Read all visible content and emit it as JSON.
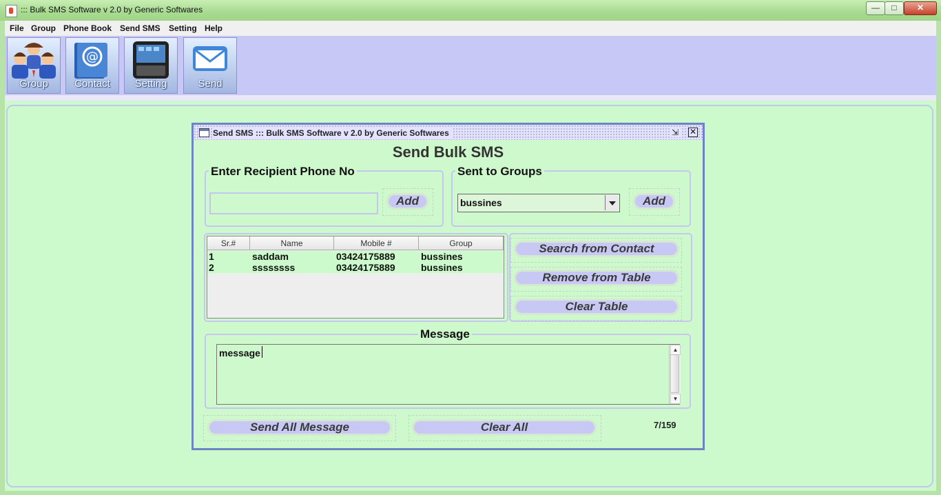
{
  "window": {
    "title": "::: Bulk SMS Software v 2.0 by Generic Softwares",
    "minimize_glyph": "—",
    "maximize_glyph": "□",
    "close_glyph": "✕"
  },
  "menu": [
    "File",
    "Group",
    "Phone Book",
    "Send SMS",
    "Setting",
    "Help"
  ],
  "toolbar": [
    {
      "label": "Group",
      "icon": "users-icon"
    },
    {
      "label": "Contact",
      "icon": "address-book-icon"
    },
    {
      "label": "Setting",
      "icon": "phone-icon"
    },
    {
      "label": "Send",
      "icon": "envelope-icon"
    }
  ],
  "internal_frame": {
    "title": "Send SMS  ::: Bulk SMS Software v 2.0 by Generic Softwares",
    "restore_glyph": "⇲",
    "close_glyph": "✕",
    "heading": "Send Bulk SMS",
    "recipient": {
      "legend": "Enter Recipient Phone No",
      "value": "",
      "add_label": "Add"
    },
    "groups": {
      "legend": "Sent to Groups",
      "selected": "bussines",
      "add_label": "Add"
    },
    "table": {
      "columns": [
        "Sr.#",
        "Name",
        "Mobile #",
        "Group"
      ],
      "rows": [
        [
          "1",
          "saddam",
          "03424175889",
          "bussines"
        ],
        [
          "2",
          "ssssssss",
          "03424175889",
          "bussines"
        ]
      ]
    },
    "actions": {
      "search": "Search from Contact",
      "remove": "Remove from Table",
      "clear_table": "Clear Table"
    },
    "message": {
      "legend": "Message",
      "value": "message"
    },
    "send_all": "Send All Message",
    "clear_all": "Clear All",
    "counter": "7/159"
  },
  "colors": {
    "desktop": "#ccfacc",
    "toolbar": "#c8c8f7",
    "frame_border": "#6e83c6",
    "button": "#c8c8f5"
  }
}
